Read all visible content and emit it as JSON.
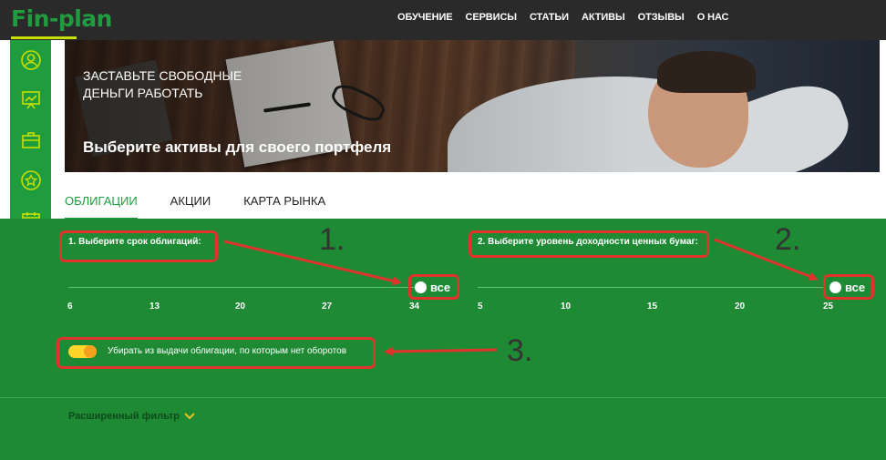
{
  "header": {
    "logo": "Fin-plan",
    "nav": [
      "ОБУЧЕНИЕ",
      "СЕРВИСЫ",
      "СТАТЬИ",
      "АКТИВЫ",
      "ОТЗЫВЫ",
      "О НАС"
    ]
  },
  "sidebar": {
    "items": [
      "user-icon",
      "analytics-icon",
      "briefcase-icon",
      "star-icon",
      "calendar-icon"
    ]
  },
  "banner": {
    "slogan": "ЗАСТАВЬТЕ СВОБОДНЫЕ ДЕНЬГИ РАБОТАТЬ",
    "headline": "Выберите активы для своего портфеля"
  },
  "tabs": [
    "ОБЛИГАЦИИ",
    "АКЦИИ",
    "КАРТА РЫНКА"
  ],
  "filters": {
    "term": {
      "label": "1. Выберите срок облигаций:",
      "ticks": [
        "6",
        "13",
        "20",
        "27",
        "34"
      ],
      "all_label": "все"
    },
    "yield": {
      "label": "2. Выберите уровень доходности ценных бумаг:",
      "ticks": [
        "5",
        "10",
        "15",
        "20",
        "25"
      ],
      "all_label": "все"
    },
    "turnover_toggle": {
      "label": "Убирать из выдачи облигации, по которым нет оборотов",
      "enabled": true
    },
    "advanced_label": "Расширенный фильтр"
  },
  "annotations": {
    "numbers": [
      "1.",
      "2.",
      "3."
    ],
    "color": "#e0332c"
  },
  "colors": {
    "brand_green": "#1f9d3e",
    "panel_green": "#1e8a34",
    "accent_yellow": "#ffd42a"
  }
}
